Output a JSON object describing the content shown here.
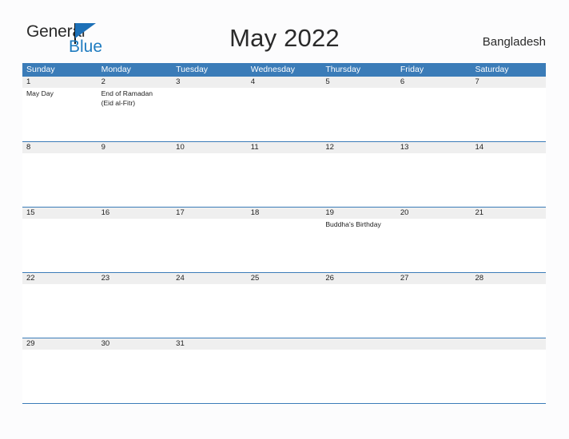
{
  "brand": {
    "name_part1": "General",
    "name_part2": "Blue",
    "flag_icon": "triangle-flag-icon",
    "colors": {
      "dark_text": "#2b2b2b",
      "blue_text": "#1f7cc0",
      "flag_blue": "#1d70b7"
    }
  },
  "header": {
    "title": "May 2022",
    "region": "Bangladesh"
  },
  "theme": {
    "header_blue": "#3b7cb8",
    "row_rule_blue": "#3b7cb8",
    "daynum_band_gray": "#efefef",
    "page_background": "#fcfcfd"
  },
  "calendar": {
    "month": "May",
    "year": "2022",
    "weekday_headers": [
      "Sunday",
      "Monday",
      "Tuesday",
      "Wednesday",
      "Thursday",
      "Friday",
      "Saturday"
    ],
    "weeks": [
      {
        "days": [
          {
            "number": "1",
            "events": [
              "May Day"
            ]
          },
          {
            "number": "2",
            "events": [
              "End of Ramadan\n(Eid al-Fitr)"
            ]
          },
          {
            "number": "3",
            "events": []
          },
          {
            "number": "4",
            "events": []
          },
          {
            "number": "5",
            "events": []
          },
          {
            "number": "6",
            "events": []
          },
          {
            "number": "7",
            "events": []
          }
        ]
      },
      {
        "days": [
          {
            "number": "8",
            "events": []
          },
          {
            "number": "9",
            "events": []
          },
          {
            "number": "10",
            "events": []
          },
          {
            "number": "11",
            "events": []
          },
          {
            "number": "12",
            "events": []
          },
          {
            "number": "13",
            "events": []
          },
          {
            "number": "14",
            "events": []
          }
        ]
      },
      {
        "days": [
          {
            "number": "15",
            "events": []
          },
          {
            "number": "16",
            "events": []
          },
          {
            "number": "17",
            "events": []
          },
          {
            "number": "18",
            "events": []
          },
          {
            "number": "19",
            "events": [
              "Buddha's Birthday"
            ]
          },
          {
            "number": "20",
            "events": []
          },
          {
            "number": "21",
            "events": []
          }
        ]
      },
      {
        "days": [
          {
            "number": "22",
            "events": []
          },
          {
            "number": "23",
            "events": []
          },
          {
            "number": "24",
            "events": []
          },
          {
            "number": "25",
            "events": []
          },
          {
            "number": "26",
            "events": []
          },
          {
            "number": "27",
            "events": []
          },
          {
            "number": "28",
            "events": []
          }
        ]
      },
      {
        "days": [
          {
            "number": "29",
            "events": []
          },
          {
            "number": "30",
            "events": []
          },
          {
            "number": "31",
            "events": []
          },
          {
            "number": "",
            "events": []
          },
          {
            "number": "",
            "events": []
          },
          {
            "number": "",
            "events": []
          },
          {
            "number": "",
            "events": []
          }
        ]
      }
    ]
  }
}
